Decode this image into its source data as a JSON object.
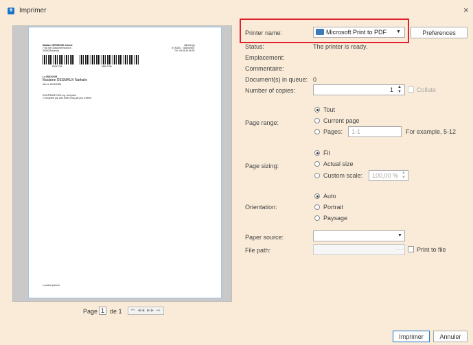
{
  "window": {
    "title": "Imprimer",
    "close": "×",
    "app_icon": "print-dialog-icon"
  },
  "preview": {
    "sender": [
      "Madame SERINGUE Jeanne",
      "7 bis rue Guillaume Brochon",
      "33000 Bordeaux"
    ],
    "right_header": [
      "infirmier(e)",
      "N° ADELI : 336000000",
      "Tél : 05 56 34 56 99"
    ],
    "barcode_left": "80047106",
    "barcode_right": "98647106",
    "date": "Le 03/03/2025",
    "patient": "Madame DESMAUX Nathalie",
    "born": "Née le 15/06/1985",
    "drug": "DOLIPRANE 1000 mg, comprimé",
    "dosage": "1 comprimé par voie orale 4 fois par jour si fièvre",
    "footer": "1 produit prescrit"
  },
  "pager": {
    "page_label": "Page",
    "page_value": "1",
    "of_label": "de 1",
    "nav": "⏮ ◀◀ ▶▶ ⏭"
  },
  "printer": {
    "name_label": "Printer name:",
    "name_value": "Microsoft Print to PDF",
    "preferences": "Preferences",
    "status_label": "Status:",
    "status_value": "The printer is ready.",
    "location_label": "Emplacement:",
    "comment_label": "Commentaire:",
    "queue_label": "Document(s) in queue:",
    "queue_value": "0",
    "copies_label": "Number of copies:",
    "copies_value": "1",
    "collate_label": "Collate"
  },
  "page_range": {
    "label": "Page range:",
    "all": "Tout",
    "current": "Current page",
    "pages": "Pages:",
    "pages_value": "1-1",
    "example": "For example, 5-12",
    "selected": "all"
  },
  "page_sizing": {
    "label": "Page sizing:",
    "fit": "Fit",
    "actual": "Actual size",
    "custom": "Custom scale:",
    "custom_value": "100,00 %",
    "selected": "fit"
  },
  "orientation": {
    "label": "Orientation:",
    "auto": "Auto",
    "portrait": "Portrait",
    "landscape": "Paysage",
    "selected": "auto"
  },
  "paper": {
    "source_label": "Paper source:",
    "source_value": ""
  },
  "file": {
    "path_label": "File path:",
    "browse": "···",
    "print_to_file": "Print to file"
  },
  "actions": {
    "print": "Imprimer",
    "cancel": "Annuler"
  },
  "colors": {
    "accent": "#1a73c7",
    "highlight": "#e0202a",
    "background": "#f9ebd8"
  }
}
